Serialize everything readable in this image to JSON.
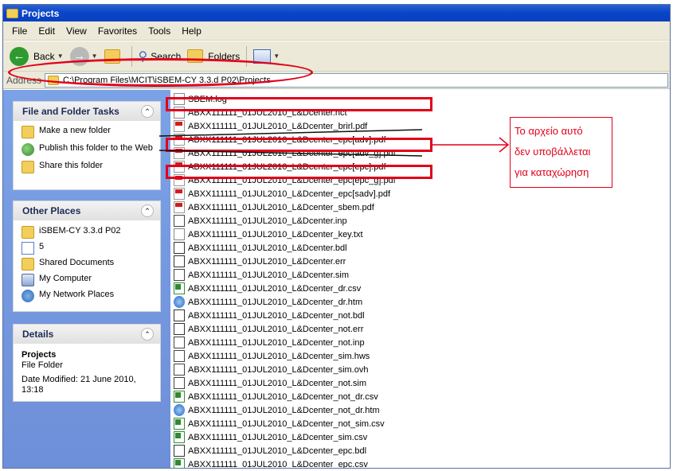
{
  "window": {
    "title": "Projects"
  },
  "menu": [
    "File",
    "Edit",
    "View",
    "Favorites",
    "Tools",
    "Help"
  ],
  "toolbar": {
    "back_label": "Back",
    "search_label": "Search",
    "folders_label": "Folders"
  },
  "address": {
    "label": "Address",
    "path": "C:\\Program Files\\MCIT\\iSBEM-CY 3.3.d P02\\Projects"
  },
  "tasks": {
    "title": "File and Folder Tasks",
    "items": [
      "Make a new folder",
      "Publish this folder to the Web",
      "Share this folder"
    ]
  },
  "other_places": {
    "title": "Other Places",
    "items": [
      "iSBEM-CY 3.3.d P02",
      "5",
      "Shared Documents",
      "My Computer",
      "My Network Places"
    ]
  },
  "details": {
    "title": "Details",
    "name": "Projects",
    "type": "File Folder",
    "modified": "Date Modified: 21 June 2010, 13:18"
  },
  "files": [
    {
      "name": "SBEM.log",
      "icon": "txt"
    },
    {
      "name": "ABXX111111_01JUL2010_L&Dcenter.nct",
      "icon": "txt"
    },
    {
      "name": "ABXX111111_01JUL2010_L&Dcenter_brirl.pdf",
      "icon": "pdf"
    },
    {
      "name": "ABXX111111_01JUL2010_L&Dcenter_epc[adv].pdf",
      "icon": "pdf"
    },
    {
      "name": "ABXX111111_01JUL2010_L&Dcenter_epc[adv_g].pdf",
      "icon": "pdf"
    },
    {
      "name": "ABXX111111_01JUL2010_L&Dcenter_epc[epc].pdf",
      "icon": "pdf"
    },
    {
      "name": "ABXX111111_01JUL2010_L&Dcenter_epc[epc_g].pdf",
      "icon": "pdf"
    },
    {
      "name": "ABXX111111_01JUL2010_L&Dcenter_epc[sadv].pdf",
      "icon": "pdf"
    },
    {
      "name": "ABXX111111_01JUL2010_L&Dcenter_sbem.pdf",
      "icon": "pdf"
    },
    {
      "name": "ABXX111111_01JUL2010_L&Dcenter.inp",
      "icon": "inp"
    },
    {
      "name": "ABXX111111_01JUL2010_L&Dcenter_key.txt",
      "icon": "txt"
    },
    {
      "name": "ABXX111111_01JUL2010_L&Dcenter.bdl",
      "icon": "bdl"
    },
    {
      "name": "ABXX111111_01JUL2010_L&Dcenter.err",
      "icon": "bdl"
    },
    {
      "name": "ABXX111111_01JUL2010_L&Dcenter.sim",
      "icon": "inp"
    },
    {
      "name": "ABXX111111_01JUL2010_L&Dcenter_dr.csv",
      "icon": "csv"
    },
    {
      "name": "ABXX111111_01JUL2010_L&Dcenter_dr.htm",
      "icon": "htm"
    },
    {
      "name": "ABXX111111_01JUL2010_L&Dcenter_not.bdl",
      "icon": "bdl"
    },
    {
      "name": "ABXX111111_01JUL2010_L&Dcenter_not.err",
      "icon": "bdl"
    },
    {
      "name": "ABXX111111_01JUL2010_L&Dcenter_not.inp",
      "icon": "inp"
    },
    {
      "name": "ABXX111111_01JUL2010_L&Dcenter_sim.hws",
      "icon": "inp"
    },
    {
      "name": "ABXX111111_01JUL2010_L&Dcenter_sim.ovh",
      "icon": "inp"
    },
    {
      "name": "ABXX111111_01JUL2010_L&Dcenter_not.sim",
      "icon": "inp"
    },
    {
      "name": "ABXX111111_01JUL2010_L&Dcenter_not_dr.csv",
      "icon": "csv"
    },
    {
      "name": "ABXX111111_01JUL2010_L&Dcenter_not_dr.htm",
      "icon": "htm"
    },
    {
      "name": "ABXX111111_01JUL2010_L&Dcenter_not_sim.csv",
      "icon": "csv"
    },
    {
      "name": "ABXX111111_01JUL2010_L&Dcenter_sim.csv",
      "icon": "csv"
    },
    {
      "name": "ABXX111111_01JUL2010_L&Dcenter_epc.bdl",
      "icon": "bdl"
    },
    {
      "name": "ABXX111111_01JUL2010_L&Dcenter_epc.csv",
      "icon": "csv"
    }
  ],
  "annotation": {
    "line1": "Το αρχείο αυτό",
    "line2": "δεν υποβάλλεται",
    "line3": "για καταχώρηση",
    "color": "#e1001a"
  }
}
